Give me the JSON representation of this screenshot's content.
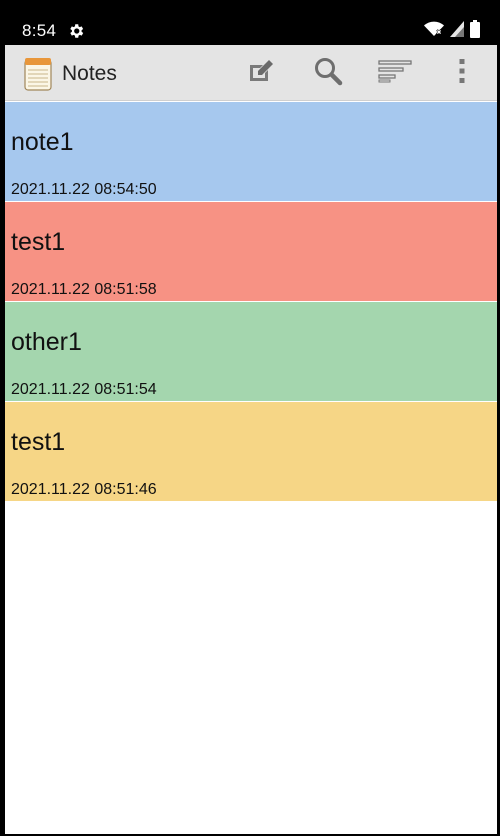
{
  "status_bar": {
    "time": "8:54",
    "icons": [
      "settings-gear-icon",
      "wifi-icon",
      "cell-signal-icon",
      "battery-icon"
    ]
  },
  "app_bar": {
    "title": "Notes",
    "actions": [
      "compose-icon",
      "search-icon",
      "sort-icon",
      "overflow-menu-icon"
    ]
  },
  "notes": [
    {
      "title": "note1",
      "date": "2021.11.22 08:54:50",
      "color": "#a6c8ee"
    },
    {
      "title": "test1",
      "date": "2021.11.22 08:51:58",
      "color": "#f79284"
    },
    {
      "title": "other1",
      "date": "2021.11.22 08:51:54",
      "color": "#a4d6ae"
    },
    {
      "title": "test1",
      "date": "2021.11.22 08:51:46",
      "color": "#f6d686"
    }
  ]
}
